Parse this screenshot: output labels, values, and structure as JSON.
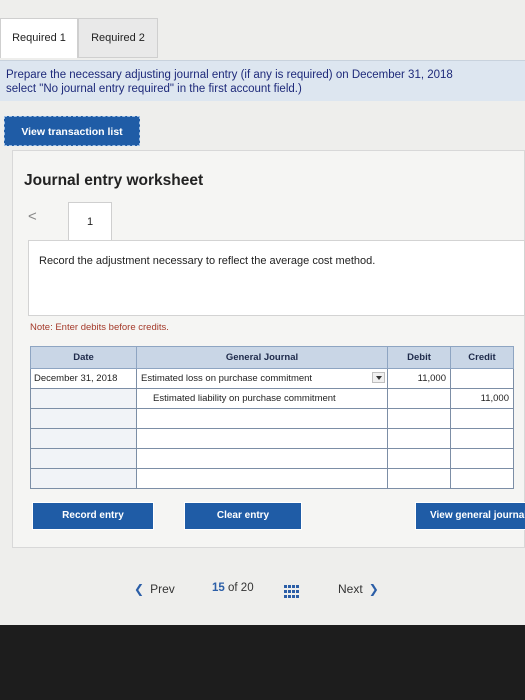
{
  "tabs": [
    {
      "label": "Required 1",
      "active": true
    },
    {
      "label": "Required 2",
      "active": false
    }
  ],
  "instruction": {
    "line1": "Prepare the necessary adjusting journal entry (if any is required) on December 31, 2018",
    "line2": "select \"No journal entry required\" in the first account field.)"
  },
  "view_transaction_label": "View transaction list",
  "worksheet": {
    "title": "Journal entry worksheet",
    "prev_arrow": "<",
    "entry_number": "1",
    "description": "Record the adjustment necessary to reflect the average cost method.",
    "note": "Note: Enter debits before credits."
  },
  "journal": {
    "headers": {
      "date": "Date",
      "account": "General Journal",
      "debit": "Debit",
      "credit": "Credit"
    },
    "rows": [
      {
        "date": "December 31, 2018",
        "account": "Estimated loss on purchase commitment",
        "debit": "11,000",
        "credit": ""
      },
      {
        "date": "",
        "account": "Estimated liability on purchase commitment",
        "debit": "",
        "credit": "11,000"
      },
      {
        "date": "",
        "account": "",
        "debit": "",
        "credit": ""
      },
      {
        "date": "",
        "account": "",
        "debit": "",
        "credit": ""
      },
      {
        "date": "",
        "account": "",
        "debit": "",
        "credit": ""
      },
      {
        "date": "",
        "account": "",
        "debit": "",
        "credit": ""
      }
    ]
  },
  "buttons": {
    "record": "Record entry",
    "clear": "Clear entry",
    "view_general": "View general journal"
  },
  "pager": {
    "prev": "Prev",
    "current": "15",
    "of_label": "of",
    "total": "20",
    "next": "Next"
  },
  "colors": {
    "accent": "#1f5ca6",
    "header": "#c9d6e6",
    "instruction_bg": "#dde6f0",
    "note": "#a43a2a"
  }
}
